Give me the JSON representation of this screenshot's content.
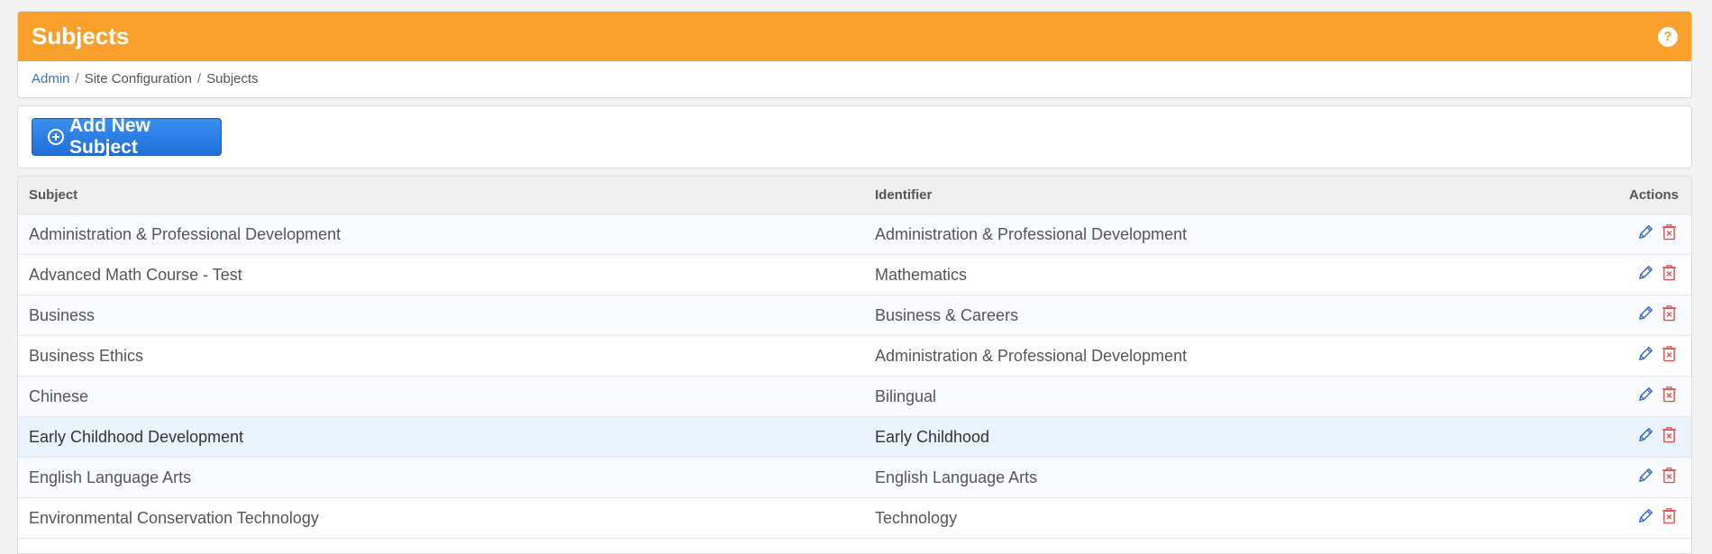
{
  "header": {
    "title": "Subjects",
    "help_label": "?"
  },
  "breadcrumb": {
    "items": [
      "Admin",
      "Site Configuration",
      "Subjects"
    ],
    "separator": "/"
  },
  "toolbar": {
    "add_label": "Add New Subject"
  },
  "table": {
    "columns": [
      "Subject",
      "Identifier",
      "Actions"
    ],
    "rows": [
      {
        "subject": "Administration & Professional Development",
        "identifier": "Administration & Professional Development"
      },
      {
        "subject": "Advanced Math Course - Test",
        "identifier": "Mathematics"
      },
      {
        "subject": "Business",
        "identifier": "Business & Careers"
      },
      {
        "subject": "Business Ethics",
        "identifier": "Administration & Professional Development"
      },
      {
        "subject": "Chinese",
        "identifier": "Bilingual"
      },
      {
        "subject": "Early Childhood Development",
        "identifier": "Early Childhood"
      },
      {
        "subject": "English Language Arts",
        "identifier": "English Language Arts"
      },
      {
        "subject": "Environmental Conservation Technology",
        "identifier": "Technology"
      }
    ]
  },
  "colors": {
    "header_bar": "#f99f2b",
    "primary_button": "#2a7de6",
    "edit_icon": "#3a6fc4",
    "delete_icon": "#d9534f",
    "highlight_row": "#eaf2fb"
  },
  "icons": {
    "help": "question-circle-icon",
    "add": "plus-circle-icon",
    "edit": "pencil-icon",
    "delete": "trash-x-icon"
  }
}
